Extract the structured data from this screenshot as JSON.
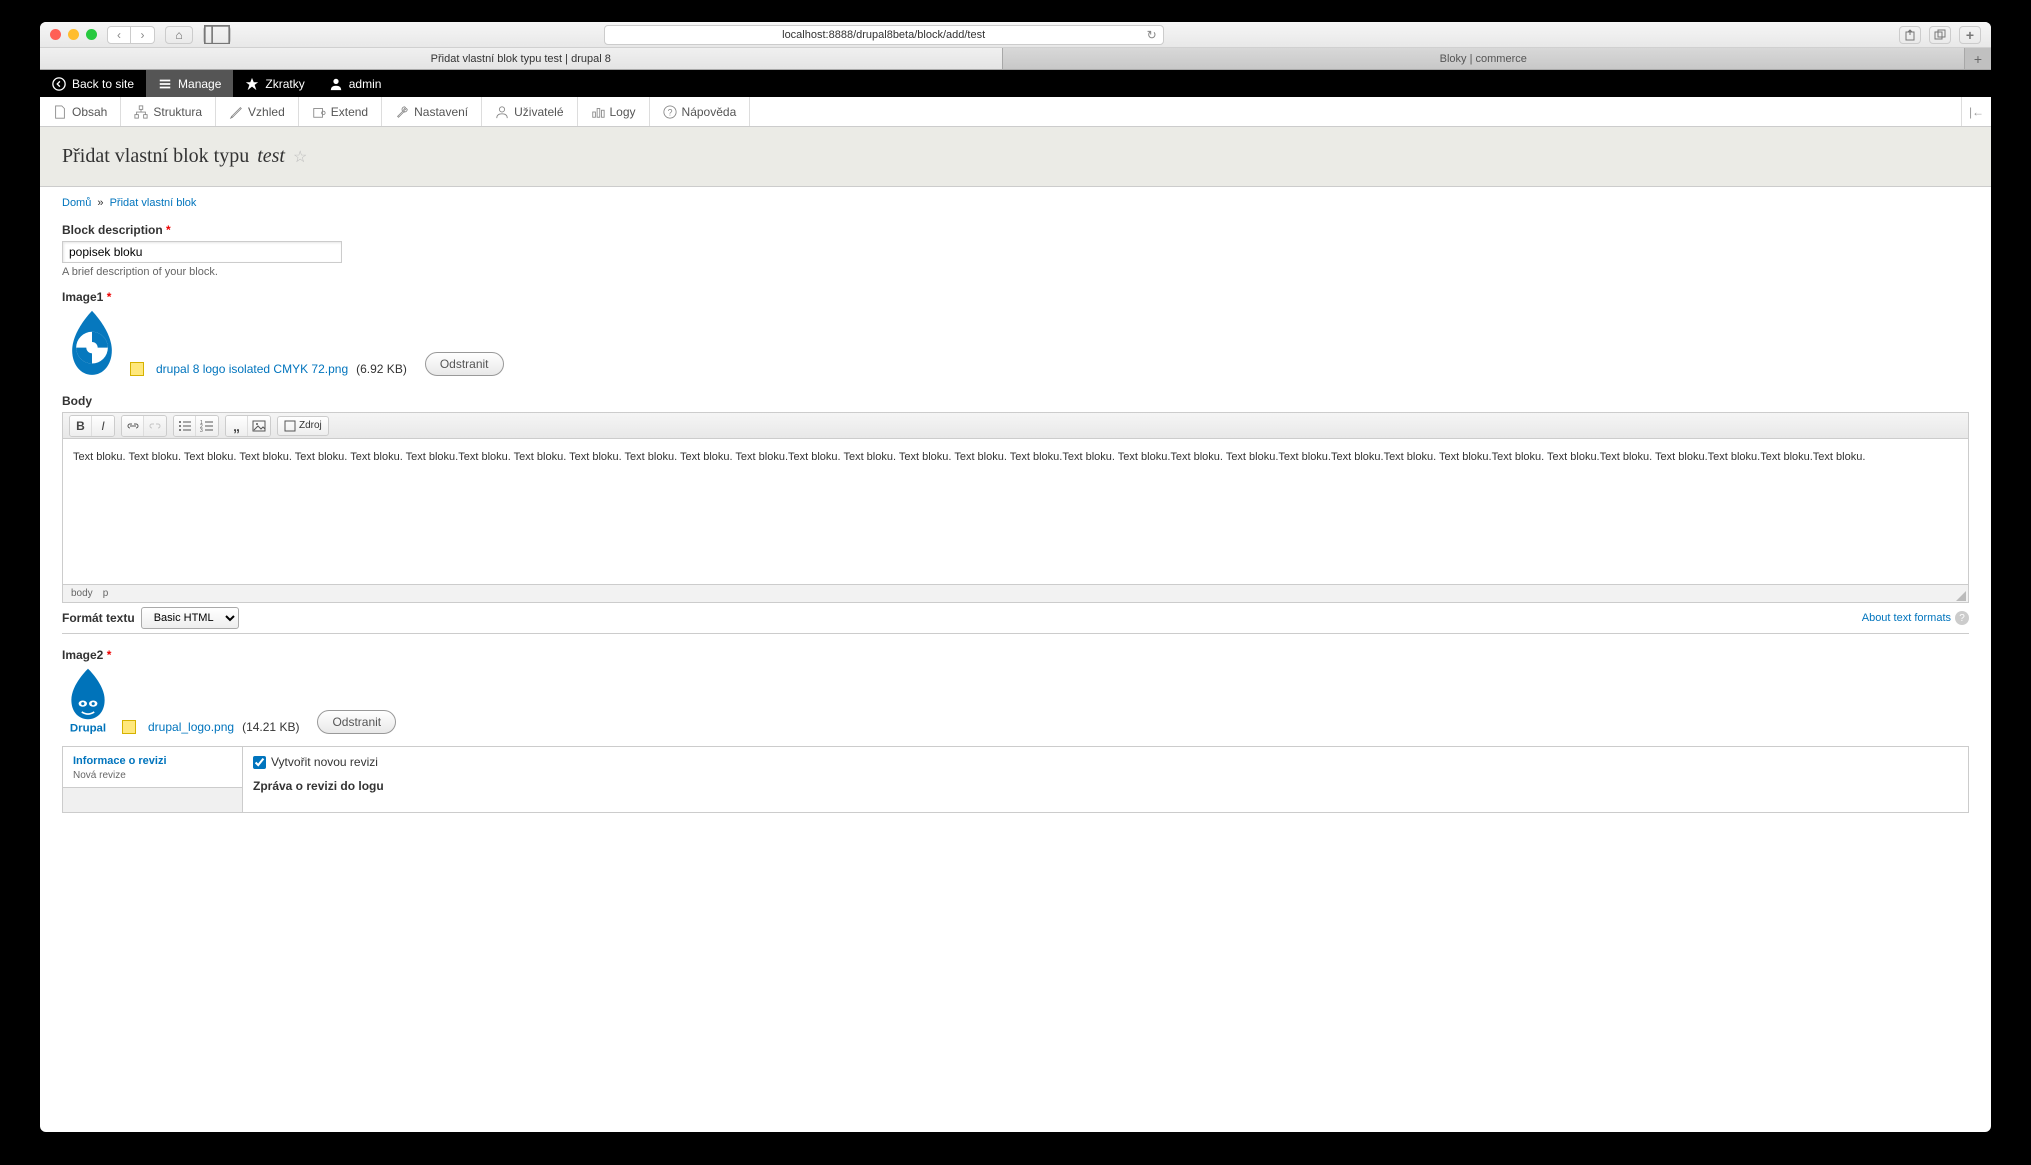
{
  "browser": {
    "url_display": "localhost:8888/drupal8beta/block/add/test",
    "tab1": "Přidat vlastní blok typu test | drupal 8",
    "tab2": "Bloky | commerce"
  },
  "toolbar": {
    "back": "Back to site",
    "manage": "Manage",
    "shortcuts": "Zkratky",
    "user": "admin"
  },
  "admin_menu": {
    "content": "Obsah",
    "structure": "Struktura",
    "appearance": "Vzhled",
    "extend": "Extend",
    "config": "Nastavení",
    "people": "Uživatelé",
    "reports": "Logy",
    "help": "Nápověda"
  },
  "page": {
    "title_pre": "Přidat vlastní blok typu ",
    "title_em": "test"
  },
  "breadcrumb": {
    "home": "Domů",
    "add": "Přidat vlastní blok"
  },
  "form": {
    "desc_label": "Block description",
    "desc_value": "popisek bloku",
    "desc_help": "A brief description of your block.",
    "image1_label": "Image1",
    "image1_file": "drupal 8 logo isolated CMYK 72.png",
    "image1_size": "(6.92 KB)",
    "remove": "Odstranit",
    "body_label": "Body",
    "body_text": "Text bloku. Text bloku. Text bloku. Text bloku. Text bloku. Text bloku. Text bloku.Text bloku. Text bloku. Text bloku. Text bloku. Text bloku. Text bloku.Text bloku. Text bloku. Text bloku. Text bloku. Text bloku.Text bloku. Text bloku.Text bloku. Text bloku.Text bloku.Text bloku.Text bloku. Text bloku.Text bloku. Text bloku.Text bloku. Text bloku.Text bloku.Text bloku.Text bloku.",
    "path_body": "body",
    "path_p": "p",
    "fmt_label": "Formát textu",
    "fmt_value": "Basic HTML",
    "about": "About text formats",
    "zdroj": "Zdroj",
    "image2_label": "Image2",
    "image2_file": "drupal_logo.png",
    "image2_size": "(14.21 KB)"
  },
  "revision": {
    "title": "Informace o revizi",
    "sub": "Nová revize",
    "create": "Vytvořit novou revizi",
    "msg_label": "Zpráva o revizi do logu"
  }
}
